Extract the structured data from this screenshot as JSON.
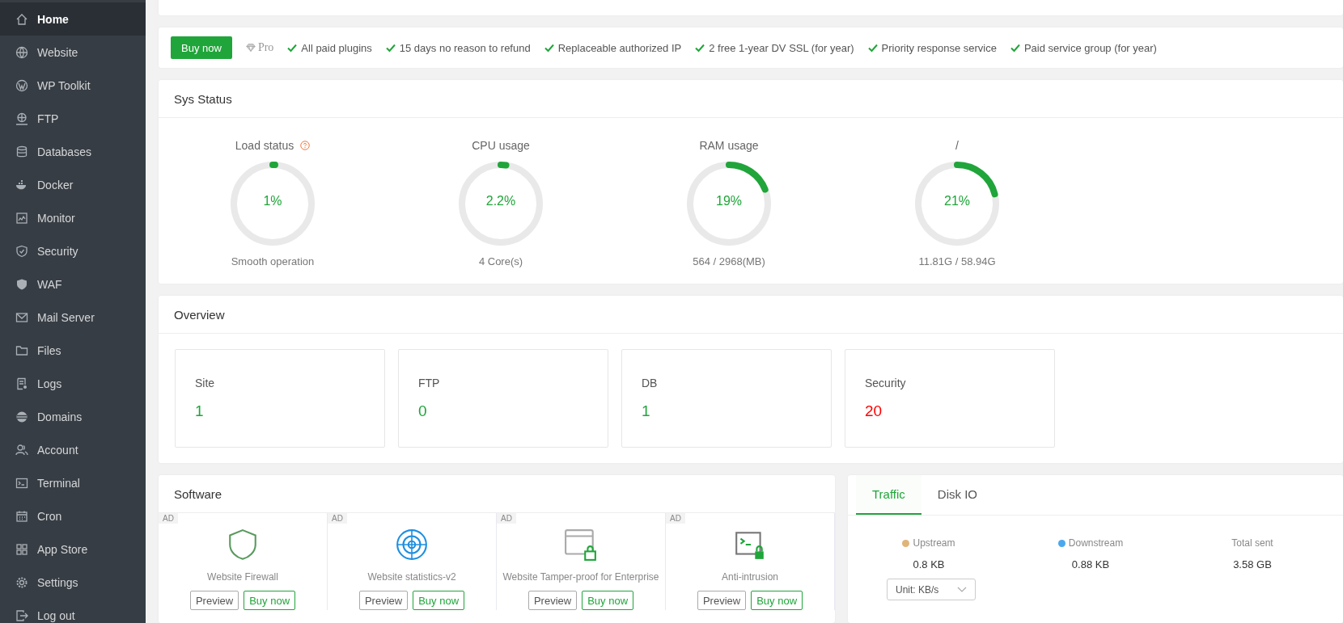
{
  "sidebar": {
    "items": [
      {
        "label": "Home",
        "selected": true
      },
      {
        "label": "Website",
        "selected": false
      },
      {
        "label": "WP Toolkit",
        "selected": false
      },
      {
        "label": "FTP",
        "selected": false
      },
      {
        "label": "Databases",
        "selected": false
      },
      {
        "label": "Docker",
        "selected": false
      },
      {
        "label": "Monitor",
        "selected": false
      },
      {
        "label": "Security",
        "selected": false
      },
      {
        "label": "WAF",
        "selected": false
      },
      {
        "label": "Mail Server",
        "selected": false
      },
      {
        "label": "Files",
        "selected": false
      },
      {
        "label": "Logs",
        "selected": false
      },
      {
        "label": "Domains",
        "selected": false
      },
      {
        "label": "Account",
        "selected": false
      },
      {
        "label": "Terminal",
        "selected": false
      },
      {
        "label": "Cron",
        "selected": false
      },
      {
        "label": "App Store",
        "selected": false
      },
      {
        "label": "Settings",
        "selected": false
      },
      {
        "label": "Log out",
        "selected": false
      }
    ]
  },
  "pro_banner": {
    "button": "Buy now",
    "badge": "Pro",
    "features": [
      "All paid plugins",
      "15 days no reason to refund",
      "Replaceable authorized IP",
      "2 free 1-year DV SSL (for year)",
      "Priority response service",
      "Paid service group (for year)"
    ]
  },
  "sys_status": {
    "title": "Sys Status",
    "gauges": [
      {
        "label": "Load status",
        "help": true,
        "value": "1%",
        "level": 0.01,
        "caption": "Smooth operation"
      },
      {
        "label": "CPU usage",
        "help": false,
        "value": "2.2%",
        "level": 0.022,
        "caption": "4 Core(s)"
      },
      {
        "label": "RAM usage",
        "help": false,
        "value": "19%",
        "level": 0.19,
        "caption": "564 / 2968(MB)"
      },
      {
        "label": "/",
        "help": false,
        "value": "21%",
        "level": 0.21,
        "caption": "11.81G / 58.94G"
      }
    ]
  },
  "overview": {
    "title": "Overview",
    "stats": [
      {
        "label": "Site",
        "value": "1",
        "warning": false
      },
      {
        "label": "FTP",
        "value": "0",
        "warning": false
      },
      {
        "label": "DB",
        "value": "1",
        "warning": false
      },
      {
        "label": "Security",
        "value": "20",
        "warning": true
      }
    ]
  },
  "software": {
    "title": "Software",
    "items": [
      {
        "badge": "AD",
        "name": "Website Firewall",
        "buttons": [
          "Preview",
          "Buy now"
        ]
      },
      {
        "badge": "AD",
        "name": "Website statistics-v2",
        "buttons": [
          "Preview",
          "Buy now"
        ]
      },
      {
        "badge": "AD",
        "name": "Website Tamper-proof for Enterprise",
        "buttons": [
          "Preview",
          "Buy now"
        ]
      },
      {
        "badge": "AD",
        "name": "Anti-intrusion",
        "buttons": [
          "Preview",
          "Buy now"
        ]
      }
    ]
  },
  "traffic": {
    "tabs": [
      {
        "label": "Traffic",
        "selected": true
      },
      {
        "label": "Disk IO",
        "selected": false
      }
    ],
    "metrics": [
      {
        "label": "Upstream",
        "value": "0.8 KB",
        "color": "#e0b57a"
      },
      {
        "label": "Downstream",
        "value": "0.88 KB",
        "color": "#4aa8ee"
      },
      {
        "label": "Total sent",
        "value": "3.58 GB"
      }
    ],
    "unit_select": "Unit: KB/s"
  }
}
